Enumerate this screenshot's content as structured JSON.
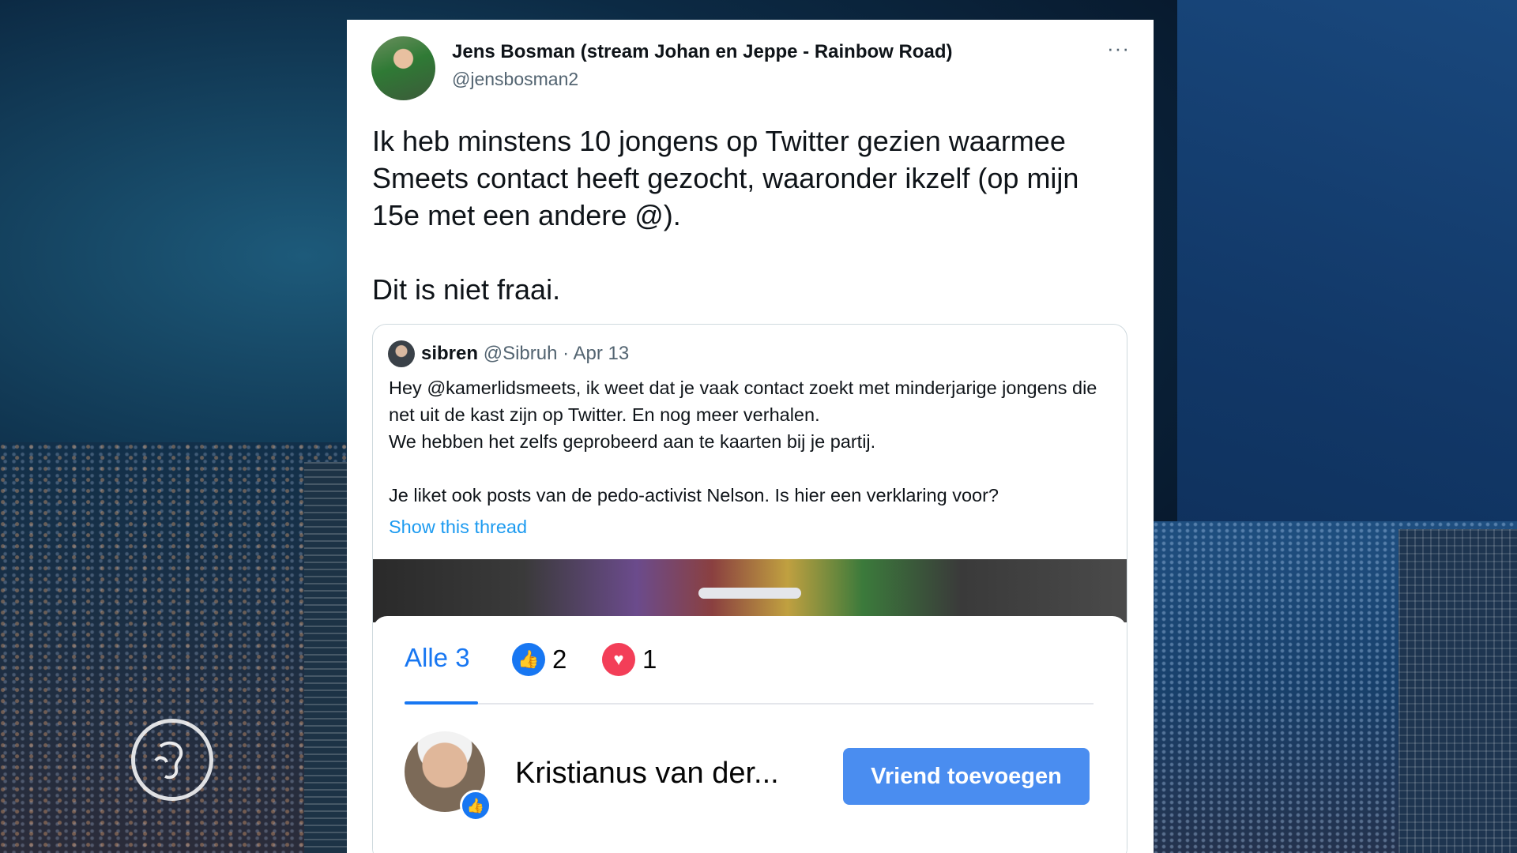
{
  "tweet": {
    "author_name": "Jens Bosman (stream Johan en Jeppe - Rainbow Road)",
    "author_handle": "@jensbosman2",
    "more_label": "···",
    "text_line1": "Ik heb minstens 10 jongens op Twitter gezien waarmee Smeets contact heeft gezocht, waaronder ikzelf (op mijn 15e met een andere @).",
    "text_line2": "Dit is niet fraai."
  },
  "quoted_tweet": {
    "author_name": "sibren",
    "author_handle": "@Sibruh",
    "separator": " · ",
    "date": "Apr 13",
    "body_line1": "Hey @kamerlidsmeets, ik weet dat je vaak contact zoekt met minderjarige jongens die net uit de kast zijn op Twitter. En nog meer verhalen.",
    "body_line2": "We hebben het zelfs geprobeerd aan te kaarten bij je partij.",
    "body_line3": "Je liket ook posts van de pedo-activist Nelson. Is hier een verklaring voor?",
    "thread_link": "Show this thread"
  },
  "embedded_reactions": {
    "tab_all": "Alle 3",
    "like_count": "2",
    "love_count": "1",
    "person_name": "Kristianus van der...",
    "add_friend_label": "Vriend toevoegen"
  },
  "icons": {
    "like": "thumbs-up-icon",
    "love": "heart-icon",
    "logo": "globe-logo-icon"
  },
  "colors": {
    "link_blue": "#1d9bf0",
    "facebook_blue": "#1877f2",
    "love_red": "#f33e58"
  }
}
